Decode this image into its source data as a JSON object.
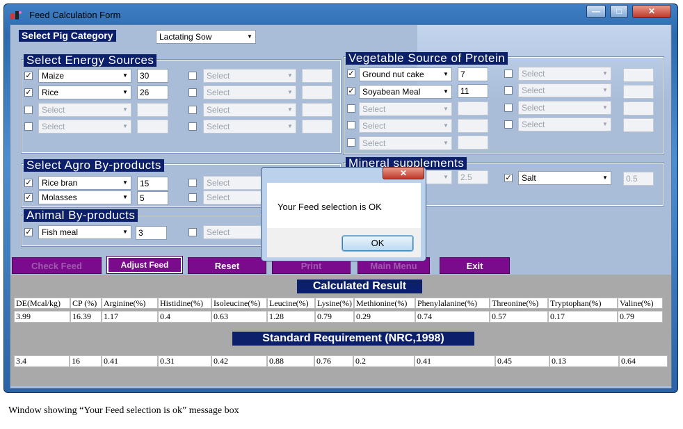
{
  "window": {
    "title": "Feed Calculation Form",
    "minimize": "—",
    "maximize": "□",
    "close": "✕"
  },
  "pig": {
    "label": "Select Pig Category",
    "value": "Lactating Sow"
  },
  "energy": {
    "legend": "Select Energy Sources",
    "left": [
      {
        "checked": true,
        "name": "Maize",
        "qty": "30"
      },
      {
        "checked": true,
        "name": "Rice",
        "qty": "26"
      },
      {
        "checked": false,
        "name": "Select",
        "qty": ""
      },
      {
        "checked": false,
        "name": "Select",
        "qty": ""
      }
    ],
    "right": [
      "Select",
      "Select",
      "Select",
      "Select"
    ]
  },
  "protein": {
    "legend": "Vegetable Source of Protein",
    "left": [
      {
        "checked": true,
        "name": "Ground nut cake",
        "qty": "7"
      },
      {
        "checked": true,
        "name": "Soyabean Meal",
        "qty": "11"
      },
      {
        "checked": false,
        "name": "Select",
        "qty": ""
      },
      {
        "checked": false,
        "name": "Select",
        "qty": ""
      },
      {
        "checked": false,
        "name": "Select",
        "qty": ""
      }
    ],
    "right": [
      "Select",
      "Select",
      "Select",
      "Select"
    ]
  },
  "agro": {
    "legend": "Select Agro By-products",
    "left": [
      {
        "checked": true,
        "name": "Rice bran",
        "qty": "15"
      },
      {
        "checked": true,
        "name": "Molasses",
        "qty": "5"
      }
    ],
    "right": [
      "Select",
      "Select"
    ]
  },
  "animal": {
    "legend": "Animal By-products",
    "left": [
      {
        "checked": true,
        "name": "Fish meal",
        "qty": "3"
      }
    ],
    "right": [
      "Select"
    ]
  },
  "mineral": {
    "legend": "Mineral supplements",
    "qty1": "2.5",
    "salt": {
      "checked": true,
      "name": "Salt",
      "qty": "0.5"
    }
  },
  "buttons": {
    "check": "Check Feed",
    "adjust": "Adjust Feed",
    "reset": "Reset",
    "print": "Print",
    "main": "Main Menu",
    "exit": "Exit"
  },
  "calculated": {
    "title": "Calculated Result",
    "headers": [
      "DE(Mcal/kg)",
      "CP (%)",
      "Arginine(%)",
      "Histidine(%)",
      "Isoleucine(%)",
      "Leucine(%)",
      "Lysine(%)",
      "Methionine(%)",
      "Phenylalanine(%)",
      "Threonine(%)",
      "Tryptophan(%)",
      "Valine(%)"
    ],
    "values": [
      "3.99",
      "16.39",
      "1.17",
      "0.4",
      "0.63",
      "1.28",
      "0.79",
      "0.29",
      "0.74",
      "0.57",
      "0.17",
      "0.79"
    ]
  },
  "standard": {
    "title": "Standard Requirement (NRC,1998)",
    "values": [
      "3.4",
      "16",
      "0.41",
      "0.31",
      "0.42",
      "0.88",
      "0.76",
      "0.2",
      "0.41",
      "0.45",
      "0.13",
      "0.64"
    ]
  },
  "dialog": {
    "message": "Your Feed selection is OK",
    "ok": "OK",
    "close": "✕"
  },
  "caption": "Window showing “Your Feed selection is ok” message box"
}
